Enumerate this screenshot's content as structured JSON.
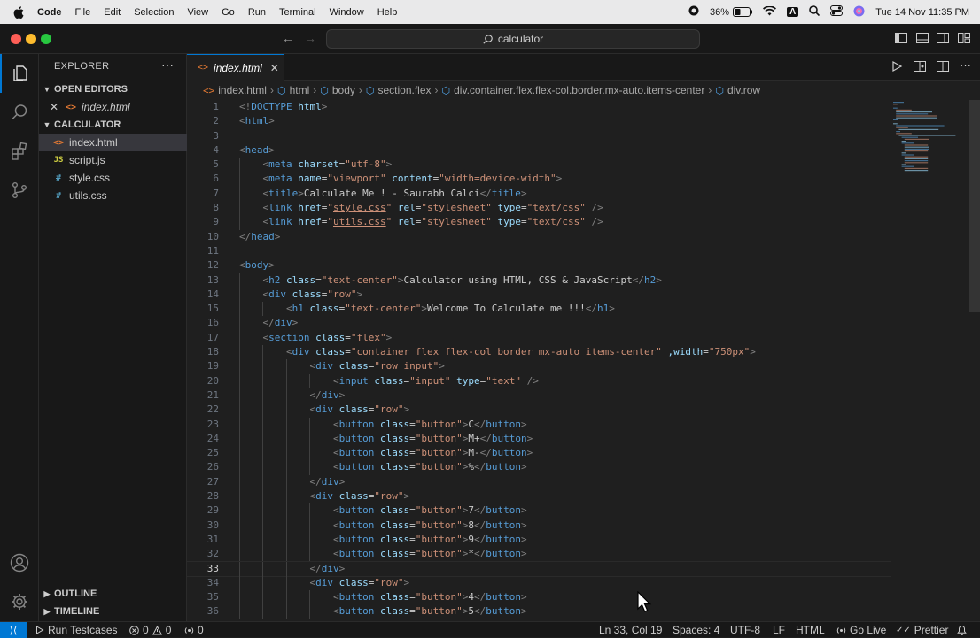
{
  "macos_menubar": {
    "app_name": "Code",
    "menus": [
      "File",
      "Edit",
      "Selection",
      "View",
      "Go",
      "Run",
      "Terminal",
      "Window",
      "Help"
    ],
    "battery": "36%",
    "datetime": "Tue 14 Nov  11:35 PM"
  },
  "titlebar": {
    "search_text": "calculator"
  },
  "sidebar": {
    "header": "EXPLORER",
    "open_editors_label": "OPEN EDITORS",
    "open_editors": [
      {
        "name": "index.html",
        "icon": "<>"
      }
    ],
    "project_label": "CALCULATOR",
    "files": [
      {
        "name": "index.html",
        "icon": "<>",
        "color": "#e37933"
      },
      {
        "name": "script.js",
        "icon": "JS",
        "color": "#cbcb41"
      },
      {
        "name": "style.css",
        "icon": "#",
        "color": "#519aba"
      },
      {
        "name": "utils.css",
        "icon": "#",
        "color": "#519aba"
      }
    ],
    "outline_label": "OUTLINE",
    "timeline_label": "TIMELINE"
  },
  "editor": {
    "tab_label": "index.html",
    "breadcrumb": [
      "index.html",
      "html",
      "body",
      "section.flex",
      "div.container.flex.flex-col.border.mx-auto.items-center",
      "div.row"
    ],
    "current_line": 33,
    "lines": [
      "<!DOCTYPE html>",
      "<html>",
      "",
      "<head>",
      "    <meta charset=\"utf-8\">",
      "    <meta name=\"viewport\" content=\"width=device-width\">",
      "    <title>Calculate Me ! - Saurabh Calci</title>",
      "    <link href=\"style.css\" rel=\"stylesheet\" type=\"text/css\" />",
      "    <link href=\"utils.css\" rel=\"stylesheet\" type=\"text/css\" />",
      "</head>",
      "",
      "<body>",
      "    <h2 class=\"text-center\">Calculator using HTML, CSS & JavaScript</h2>",
      "    <div class=\"row\">",
      "        <h1 class=\"text-center\">Welcome To Calculate me !!!</h1>",
      "    </div>",
      "    <section class=\"flex\">",
      "        <div class=\"container flex flex-col border mx-auto items-center\" ,width=\"750px\">",
      "            <div class=\"row input\">",
      "                <input class=\"input\" type=\"text\" />",
      "            </div>",
      "            <div class=\"row\">",
      "                <button class=\"button\">C</button>",
      "                <button class=\"button\">M+</button>",
      "                <button class=\"button\">M-</button>",
      "                <button class=\"button\">%</button>",
      "            </div>",
      "            <div class=\"row\">",
      "                <button class=\"button\">7</button>",
      "                <button class=\"button\">8</button>",
      "                <button class=\"button\">9</button>",
      "                <button class=\"button\">*</button>",
      "            </div>",
      "            <div class=\"row\">",
      "                <button class=\"button\">4</button>",
      "                <button class=\"button\">5</button>"
    ]
  },
  "statusbar": {
    "run_testcases": "Run Testcases",
    "errors": "0",
    "warnings": "0",
    "ports": "0",
    "cursor": "Ln 33, Col 19",
    "spaces": "Spaces: 4",
    "encoding": "UTF-8",
    "eol": "LF",
    "language": "HTML",
    "go_live": "Go Live",
    "prettier": "Prettier"
  },
  "colors": {
    "accent": "#0078d4",
    "tag": "#569cd6",
    "attr": "#9cdcfe",
    "string": "#ce9178"
  }
}
